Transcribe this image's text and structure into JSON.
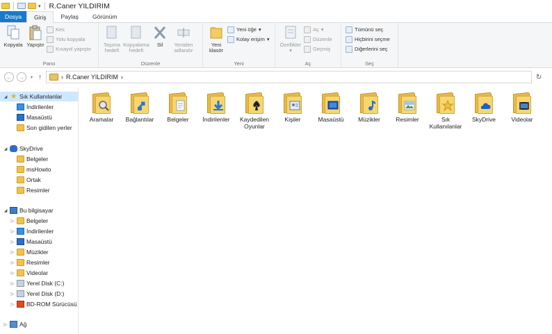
{
  "window": {
    "title": "R.Caner YILDIRIM"
  },
  "tabs": [
    "Dosya",
    "Giriş",
    "Paylaş",
    "Görünüm"
  ],
  "ribbon": {
    "pano": {
      "label": "Pano",
      "kopyala": "Kopyala",
      "yapistir": "Yapıştır",
      "kes": "Kes",
      "yolu_kopyala": "Yolu kopyala",
      "kisayol_yapistir": "Kısayol yapıştır"
    },
    "duzenle": {
      "label": "Düzenle",
      "tasima_l1": "Taşıma",
      "tasima_l2": "hedefi",
      "kopyalama_l1": "Kopyalama",
      "kopyalama_l2": "hedefi",
      "sil": "Sil",
      "yeniden_l1": "Yeniden",
      "yeniden_l2": "adlandır"
    },
    "yeni": {
      "label": "Yeni",
      "klasor_l1": "Yeni",
      "klasor_l2": "klasör",
      "yeni_oge": "Yeni öğe",
      "kolay_erisim": "Kolay erişim"
    },
    "ac": {
      "label": "Aç",
      "ozellikler": "Özellikler",
      "ac": "Aç",
      "duzenle": "Düzenle",
      "gecmis": "Geçmiş"
    },
    "sec": {
      "label": "Seç",
      "tumunu": "Tümünü seç",
      "hicbirini": "Hiçbirini seçme",
      "digerlerini": "Diğerlerini seç"
    }
  },
  "address": {
    "path": "R.Caner YILDIRIM"
  },
  "nav": [
    {
      "label": "Sık Kullanılanlar",
      "icon": "star",
      "arrow": "◢",
      "level": 0,
      "selected": true
    },
    {
      "label": "İndirilenler",
      "icon": "dl",
      "level": 1
    },
    {
      "label": "Masaüstü",
      "icon": "desk",
      "level": 1
    },
    {
      "label": "Son gidilen yerler",
      "icon": "folder",
      "level": 1
    },
    {
      "label": "SkyDrive",
      "icon": "sky",
      "arrow": "◢",
      "level": 0
    },
    {
      "label": "Belgeler",
      "icon": "folder",
      "level": 1
    },
    {
      "label": "msHowto",
      "icon": "folder",
      "level": 1
    },
    {
      "label": "Ortak",
      "icon": "folder",
      "level": 1
    },
    {
      "label": "Resimler",
      "icon": "folder",
      "level": 1
    },
    {
      "label": "Bu bilgisayar",
      "icon": "pc",
      "arrow": "◢",
      "level": 0
    },
    {
      "label": "Belgeler",
      "icon": "folder",
      "arrow": "▷",
      "level": 1
    },
    {
      "label": "İndirilenler",
      "icon": "dl",
      "arrow": "▷",
      "level": 1
    },
    {
      "label": "Masaüstü",
      "icon": "desk",
      "arrow": "▷",
      "level": 1
    },
    {
      "label": "Müzikler",
      "icon": "folder",
      "arrow": "▷",
      "level": 1
    },
    {
      "label": "Resimler",
      "icon": "folder",
      "arrow": "▷",
      "level": 1
    },
    {
      "label": "Videolar",
      "icon": "folder",
      "arrow": "▷",
      "level": 1
    },
    {
      "label": "Yerel Disk (C:)",
      "icon": "disk",
      "arrow": "▷",
      "level": 1
    },
    {
      "label": "Yerel Disk (D:)",
      "icon": "disk",
      "arrow": "▷",
      "level": 1
    },
    {
      "label": "BD-ROM Sürücüsü (",
      "icon": "bd",
      "arrow": "▷",
      "level": 1
    },
    {
      "label": "Ağ",
      "icon": "net",
      "arrow": "▷",
      "level": 0
    }
  ],
  "items": [
    {
      "label": "Aramalar",
      "overlay": "search"
    },
    {
      "label": "Bağlantılar",
      "overlay": "link"
    },
    {
      "label": "Belgeler",
      "overlay": "doc"
    },
    {
      "label": "İndirilenler",
      "overlay": "download"
    },
    {
      "label": "Kaydedilen Oyunlar",
      "overlay": "games"
    },
    {
      "label": "Kişiler",
      "overlay": "contacts"
    },
    {
      "label": "Masaüstü",
      "overlay": "desktop"
    },
    {
      "label": "Müzikler",
      "overlay": "music"
    },
    {
      "label": "Resimler",
      "overlay": "pictures"
    },
    {
      "label": "Sık Kullanılanlar",
      "overlay": "star"
    },
    {
      "label": "SkyDrive",
      "overlay": "cloud"
    },
    {
      "label": "Videolar",
      "overlay": "video"
    }
  ]
}
